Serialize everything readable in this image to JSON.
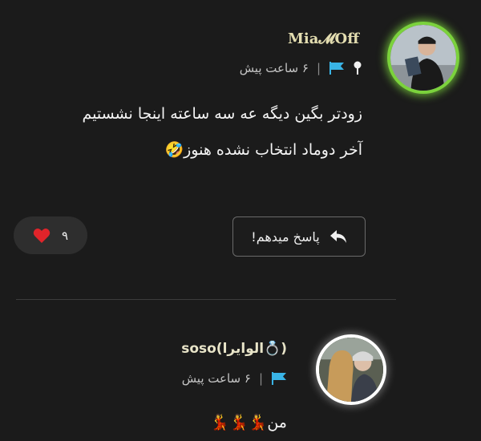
{
  "comments": [
    {
      "username": "Mia𝓜Off",
      "time": "۶ ساعت پیش",
      "separator": "|",
      "lines": [
        "زودتر بگین دیگه عه سه ساعته اینجا نشستیم",
        "آخر دوماد انتخاب نشده هنوز🤣"
      ],
      "reply_label": "پاسخ میدهم!",
      "likes": "۹",
      "avatar_ring_color": "#7bd23c"
    },
    {
      "username": "soso(الوایرا💍)",
      "time": "۶ ساعت پیش",
      "separator": "|",
      "lines": [
        "من💃💃💃"
      ],
      "avatar_ring_color": "#ffffff"
    }
  ],
  "icons": {
    "flag": "flag-icon",
    "pin": "pin-icon",
    "reply": "reply-arrow-icon",
    "heart": "heart-icon"
  },
  "colors": {
    "background": "#1b1b1b",
    "flag": "#39b4e6",
    "heart": "#e0242a"
  }
}
